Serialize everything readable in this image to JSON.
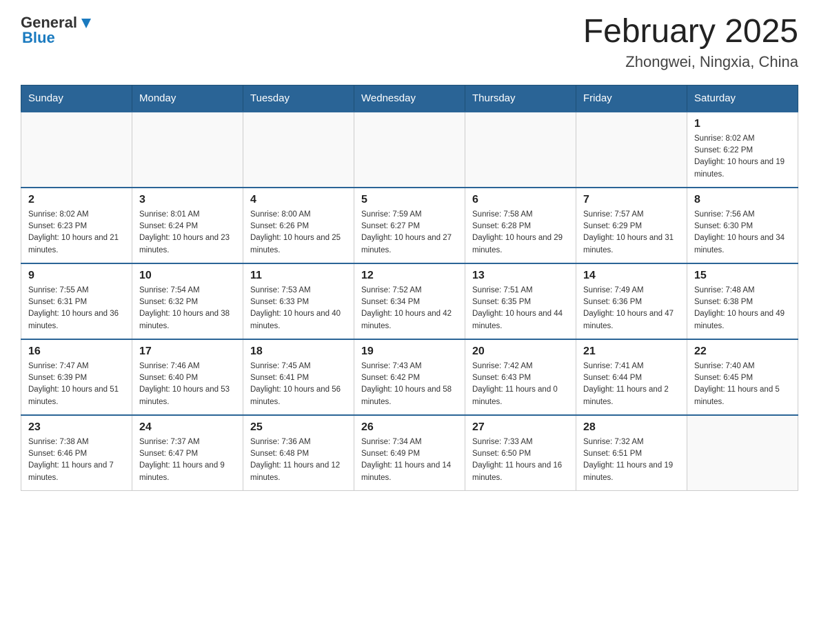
{
  "header": {
    "logo_general": "General",
    "logo_blue": "Blue",
    "title": "February 2025",
    "location": "Zhongwei, Ningxia, China"
  },
  "weekdays": [
    "Sunday",
    "Monday",
    "Tuesday",
    "Wednesday",
    "Thursday",
    "Friday",
    "Saturday"
  ],
  "weeks": [
    [
      {
        "day": "",
        "info": ""
      },
      {
        "day": "",
        "info": ""
      },
      {
        "day": "",
        "info": ""
      },
      {
        "day": "",
        "info": ""
      },
      {
        "day": "",
        "info": ""
      },
      {
        "day": "",
        "info": ""
      },
      {
        "day": "1",
        "info": "Sunrise: 8:02 AM\nSunset: 6:22 PM\nDaylight: 10 hours and 19 minutes."
      }
    ],
    [
      {
        "day": "2",
        "info": "Sunrise: 8:02 AM\nSunset: 6:23 PM\nDaylight: 10 hours and 21 minutes."
      },
      {
        "day": "3",
        "info": "Sunrise: 8:01 AM\nSunset: 6:24 PM\nDaylight: 10 hours and 23 minutes."
      },
      {
        "day": "4",
        "info": "Sunrise: 8:00 AM\nSunset: 6:26 PM\nDaylight: 10 hours and 25 minutes."
      },
      {
        "day": "5",
        "info": "Sunrise: 7:59 AM\nSunset: 6:27 PM\nDaylight: 10 hours and 27 minutes."
      },
      {
        "day": "6",
        "info": "Sunrise: 7:58 AM\nSunset: 6:28 PM\nDaylight: 10 hours and 29 minutes."
      },
      {
        "day": "7",
        "info": "Sunrise: 7:57 AM\nSunset: 6:29 PM\nDaylight: 10 hours and 31 minutes."
      },
      {
        "day": "8",
        "info": "Sunrise: 7:56 AM\nSunset: 6:30 PM\nDaylight: 10 hours and 34 minutes."
      }
    ],
    [
      {
        "day": "9",
        "info": "Sunrise: 7:55 AM\nSunset: 6:31 PM\nDaylight: 10 hours and 36 minutes."
      },
      {
        "day": "10",
        "info": "Sunrise: 7:54 AM\nSunset: 6:32 PM\nDaylight: 10 hours and 38 minutes."
      },
      {
        "day": "11",
        "info": "Sunrise: 7:53 AM\nSunset: 6:33 PM\nDaylight: 10 hours and 40 minutes."
      },
      {
        "day": "12",
        "info": "Sunrise: 7:52 AM\nSunset: 6:34 PM\nDaylight: 10 hours and 42 minutes."
      },
      {
        "day": "13",
        "info": "Sunrise: 7:51 AM\nSunset: 6:35 PM\nDaylight: 10 hours and 44 minutes."
      },
      {
        "day": "14",
        "info": "Sunrise: 7:49 AM\nSunset: 6:36 PM\nDaylight: 10 hours and 47 minutes."
      },
      {
        "day": "15",
        "info": "Sunrise: 7:48 AM\nSunset: 6:38 PM\nDaylight: 10 hours and 49 minutes."
      }
    ],
    [
      {
        "day": "16",
        "info": "Sunrise: 7:47 AM\nSunset: 6:39 PM\nDaylight: 10 hours and 51 minutes."
      },
      {
        "day": "17",
        "info": "Sunrise: 7:46 AM\nSunset: 6:40 PM\nDaylight: 10 hours and 53 minutes."
      },
      {
        "day": "18",
        "info": "Sunrise: 7:45 AM\nSunset: 6:41 PM\nDaylight: 10 hours and 56 minutes."
      },
      {
        "day": "19",
        "info": "Sunrise: 7:43 AM\nSunset: 6:42 PM\nDaylight: 10 hours and 58 minutes."
      },
      {
        "day": "20",
        "info": "Sunrise: 7:42 AM\nSunset: 6:43 PM\nDaylight: 11 hours and 0 minutes."
      },
      {
        "day": "21",
        "info": "Sunrise: 7:41 AM\nSunset: 6:44 PM\nDaylight: 11 hours and 2 minutes."
      },
      {
        "day": "22",
        "info": "Sunrise: 7:40 AM\nSunset: 6:45 PM\nDaylight: 11 hours and 5 minutes."
      }
    ],
    [
      {
        "day": "23",
        "info": "Sunrise: 7:38 AM\nSunset: 6:46 PM\nDaylight: 11 hours and 7 minutes."
      },
      {
        "day": "24",
        "info": "Sunrise: 7:37 AM\nSunset: 6:47 PM\nDaylight: 11 hours and 9 minutes."
      },
      {
        "day": "25",
        "info": "Sunrise: 7:36 AM\nSunset: 6:48 PM\nDaylight: 11 hours and 12 minutes."
      },
      {
        "day": "26",
        "info": "Sunrise: 7:34 AM\nSunset: 6:49 PM\nDaylight: 11 hours and 14 minutes."
      },
      {
        "day": "27",
        "info": "Sunrise: 7:33 AM\nSunset: 6:50 PM\nDaylight: 11 hours and 16 minutes."
      },
      {
        "day": "28",
        "info": "Sunrise: 7:32 AM\nSunset: 6:51 PM\nDaylight: 11 hours and 19 minutes."
      },
      {
        "day": "",
        "info": ""
      }
    ]
  ]
}
